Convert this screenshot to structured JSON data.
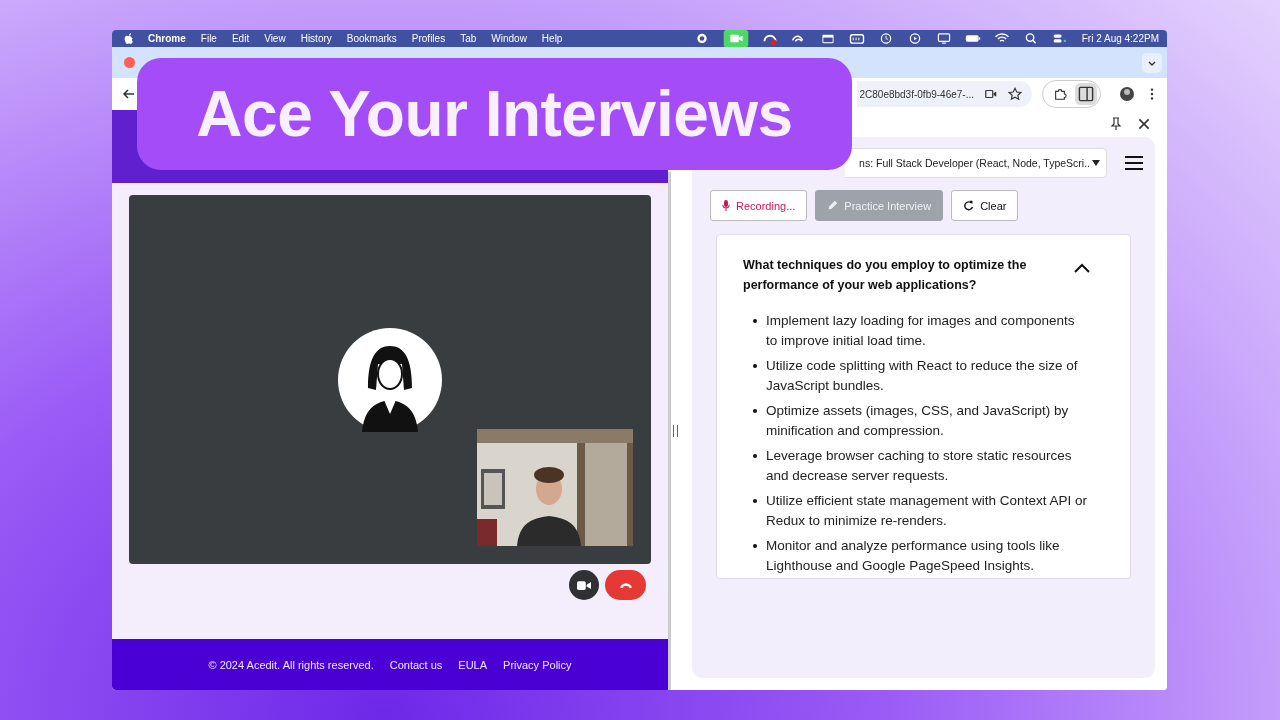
{
  "banner": {
    "title": "Ace Your Interviews"
  },
  "menu_bar": {
    "app": "Chrome",
    "menus": [
      "File",
      "Edit",
      "View",
      "History",
      "Bookmarks",
      "Profiles",
      "Tab",
      "Window",
      "Help"
    ],
    "clock": "Fri 2 Aug  4:22PM"
  },
  "browser": {
    "url": "2C80e8bd3f-0fb9-46e7-..."
  },
  "page": {
    "footer": {
      "copyright": "© 2024 Acedit. All rights reserved.",
      "links": [
        "Contact us",
        "EULA",
        "Privacy Policy"
      ]
    }
  },
  "side_panel": {
    "role_select": "ns: Full Stack Developer (React, Node, TypeScri..",
    "buttons": [
      {
        "label": "Recording...",
        "kind": "recording",
        "disabled": false
      },
      {
        "label": "Practice Interview",
        "kind": "practice",
        "disabled": true
      },
      {
        "label": "Clear",
        "kind": "clear",
        "disabled": false
      }
    ],
    "question": {
      "text": "What techniques do you employ to optimize the performance of your web applications?",
      "expanded": true,
      "answers": [
        "Implement lazy loading for images and components to improve initial load time.",
        "Utilize code splitting with React to reduce the size of JavaScript bundles.",
        "Optimize assets (images, CSS, and JavaScript) by minification and compression.",
        "Leverage browser caching to store static resources and decrease server requests.",
        "Utilize efficient state management with Context API or Redux to minimize re-renders.",
        "Monitor and analyze performance using tools like Lighthouse and Google PageSpeed Insights."
      ]
    }
  }
}
